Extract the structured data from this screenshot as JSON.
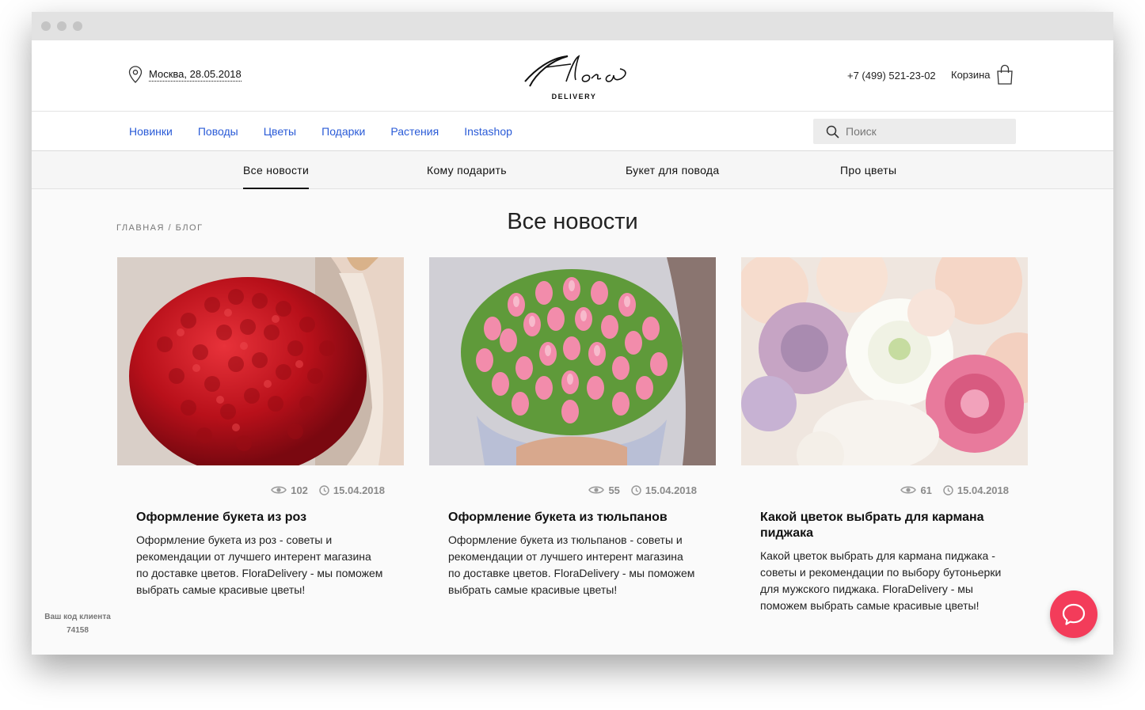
{
  "header": {
    "location": "Москва, 28.05.2018",
    "logo_script": "Flora",
    "logo_sub": "DELIVERY",
    "phone": "+7 (499) 521-23-02",
    "cart_label": "Корзина"
  },
  "nav": {
    "links": [
      "Новинки",
      "Поводы",
      "Цветы",
      "Подарки",
      "Растения",
      "Instashop"
    ],
    "search_placeholder": "Поиск"
  },
  "subnav": {
    "tabs": [
      "Все новости",
      "Кому подарить",
      "Букет для повода",
      "Про цветы"
    ],
    "active_tab": "Все новости"
  },
  "breadcrumb": "ГЛАВНАЯ / БЛОГ",
  "page_title": "Все новости",
  "cards": [
    {
      "views": "102",
      "date": "15.04.2018",
      "title": "Оформление букета из роз",
      "text": "Оформление букета из роз - советы и рекомендации от лучшего интерент магазина по доставке цветов. FloraDelivery - мы поможем выбрать самые красивые цветы!"
    },
    {
      "views": "55",
      "date": "15.04.2018",
      "title": "Оформление букета из тюльпанов",
      "text": "Оформление букета из тюльпанов - советы и рекомендации от лучшего интерент магазина по доставке цветов. FloraDelivery - мы поможем выбрать самые красивые цветы!"
    },
    {
      "views": "61",
      "date": "15.04.2018",
      "title": "Какой цветок выбрать для кармана пиджака",
      "text": "Какой цветок выбрать для кармана пиджака - советы и рекомендации по выбору бутоньерки для мужского пиджака. FloraDelivery - мы поможем выбрать самые красивые цветы!"
    }
  ],
  "client_code": {
    "label": "Ваш код клиента",
    "value": "74158"
  },
  "colors": {
    "nav_link": "#2a5bd7",
    "chat_button": "#f33c5a",
    "meta_text": "#8a8a8a"
  },
  "icons": {
    "location": "map-pin-icon",
    "cart": "shopping-bag-icon",
    "search": "magnifier-icon",
    "views": "eye-icon",
    "date": "clock-icon",
    "chat": "chat-bubble-icon"
  }
}
